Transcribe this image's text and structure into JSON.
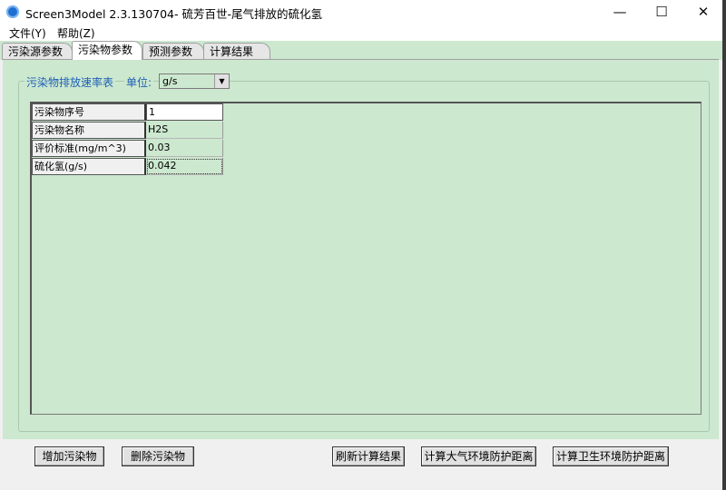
{
  "window": {
    "title": "Screen3Model 2.3.130704- 硫芳百世-尾气排放的硫化氢",
    "controls": {
      "minimize": "—",
      "maximize": "☐",
      "close": "✕"
    }
  },
  "menu": [
    "文件(Y)",
    "帮助(Z)"
  ],
  "tabs": [
    {
      "label": "污染源参数",
      "active": false
    },
    {
      "label": "污染物参数",
      "active": true
    },
    {
      "label": "预测参数",
      "active": false
    },
    {
      "label": "计算结果",
      "active": false
    }
  ],
  "group": {
    "legend": "污染物排放速率表",
    "unit_label": "单位:",
    "unit_value": "g/s"
  },
  "grid_rows": [
    {
      "header": "污染物序号",
      "value": "1"
    },
    {
      "header": "污染物名称",
      "value": "H2S"
    },
    {
      "header": "评价标准(mg/m^3)",
      "value": "0.03"
    },
    {
      "header": "硫化氢(g/s)",
      "value": "0.042"
    }
  ],
  "buttons": {
    "add": "增加污染物",
    "delete": "删除污染物",
    "refresh": "刷新计算结果",
    "calc_air": "计算大气环境防护距离",
    "calc_health": "计算卫生环境防护距离"
  },
  "colors": {
    "panel_bg": "#cce8cf",
    "accent_text": "#1d5fb4",
    "app_icon": "#1e6fd1"
  }
}
